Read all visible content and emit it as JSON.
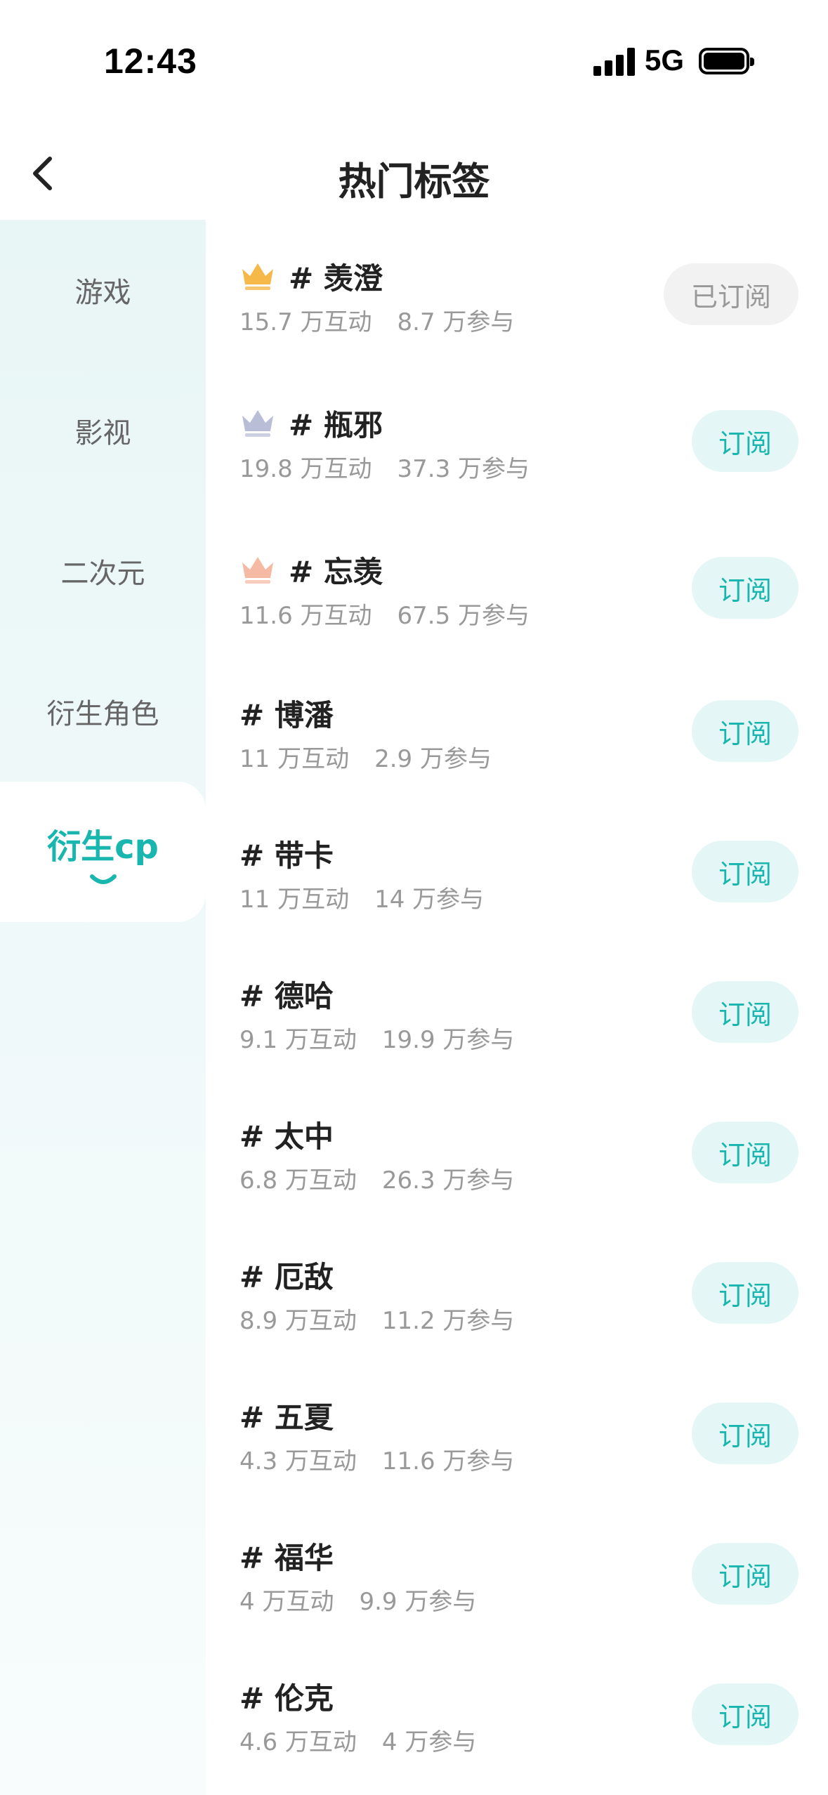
{
  "status_bar": {
    "time": "12:43",
    "network": "5G"
  },
  "header": {
    "title": "热门标签",
    "back_icon": "chevron-left-icon"
  },
  "sidebar": {
    "items": [
      {
        "label": "游戏",
        "active": false
      },
      {
        "label": "影视",
        "active": false
      },
      {
        "label": "二次元",
        "active": false
      },
      {
        "label": "衍生角色",
        "active": false
      },
      {
        "label": "衍生cp",
        "active": true
      }
    ],
    "accent_color": "#19b6b0"
  },
  "tags": [
    {
      "name": "# 羡澄",
      "interactions": "15.7 万互动",
      "participants": "8.7 万参与",
      "rank_icon": "gold-crown-icon",
      "button": "已订阅",
      "subscribed": true
    },
    {
      "name": "# 瓶邪",
      "interactions": "19.8 万互动",
      "participants": "37.3 万参与",
      "rank_icon": "silver-crown-icon",
      "button": "订阅",
      "subscribed": false
    },
    {
      "name": "# 忘羡",
      "interactions": "11.6 万互动",
      "participants": "67.5 万参与",
      "rank_icon": "bronze-crown-icon",
      "button": "订阅",
      "subscribed": false
    },
    {
      "name": "# 博潘",
      "interactions": "11 万互动",
      "participants": "2.9 万参与",
      "button": "订阅",
      "subscribed": false
    },
    {
      "name": "# 带卡",
      "interactions": "11 万互动",
      "participants": "14 万参与",
      "button": "订阅",
      "subscribed": false
    },
    {
      "name": "# 德哈",
      "interactions": "9.1 万互动",
      "participants": "19.9 万参与",
      "button": "订阅",
      "subscribed": false
    },
    {
      "name": "# 太中",
      "interactions": "6.8 万互动",
      "participants": "26.3 万参与",
      "button": "订阅",
      "subscribed": false
    },
    {
      "name": "# 厄敌",
      "interactions": "8.9 万互动",
      "participants": "11.2 万参与",
      "button": "订阅",
      "subscribed": false
    },
    {
      "name": "# 五夏",
      "interactions": "4.3 万互动",
      "participants": "11.6 万参与",
      "button": "订阅",
      "subscribed": false
    },
    {
      "name": "# 福华",
      "interactions": "4 万互动",
      "participants": "9.9 万参与",
      "button": "订阅",
      "subscribed": false
    },
    {
      "name": "# 伦克",
      "interactions": "4.6 万互动",
      "participants": "4 万参与",
      "button": "订阅",
      "subscribed": false
    }
  ]
}
